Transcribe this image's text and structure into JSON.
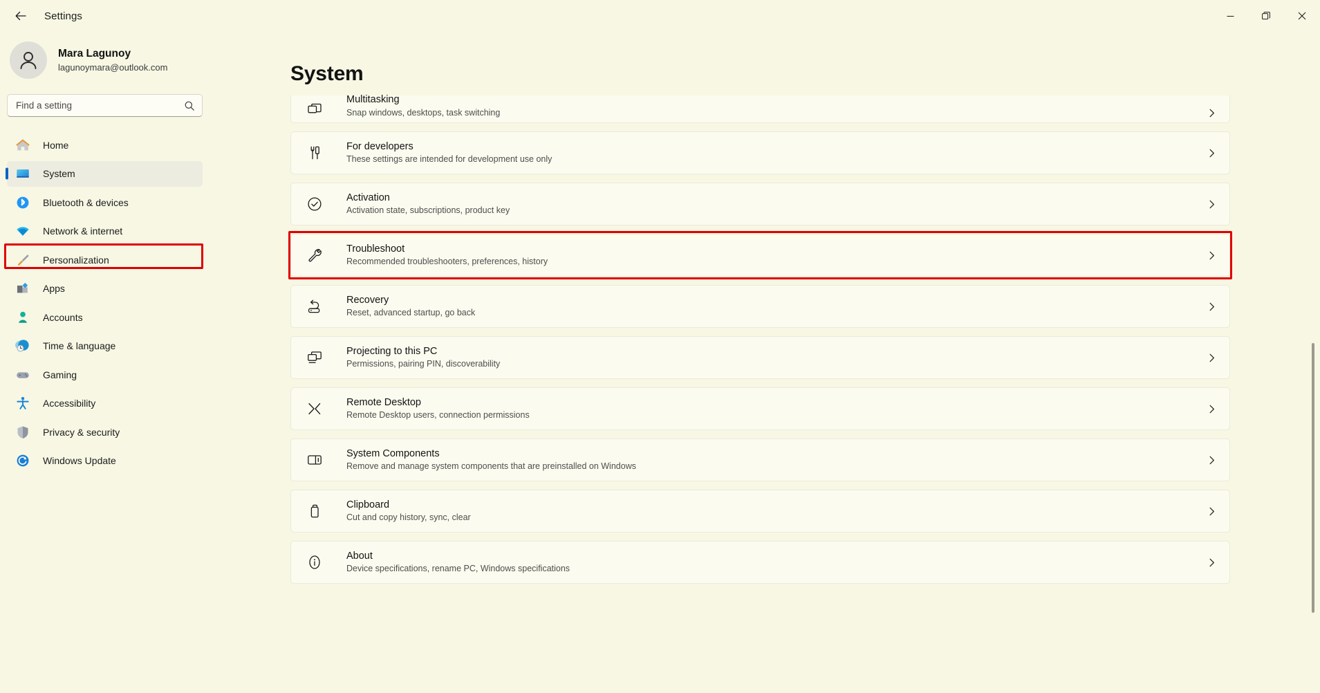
{
  "window": {
    "title": "Settings",
    "back_icon": "back-arrow-icon",
    "minimize_label": "Minimize",
    "maximize_label": "Restore",
    "close_label": "Close"
  },
  "account": {
    "name": "Mara Lagunoy",
    "email": "lagunoymara@outlook.com",
    "avatar_icon": "person-avatar-icon"
  },
  "search": {
    "placeholder": "Find a setting",
    "value": "",
    "icon": "search-icon"
  },
  "sidebar": {
    "items": [
      {
        "label": "Home",
        "icon": "home-icon",
        "selected": false
      },
      {
        "label": "System",
        "icon": "system-monitor-icon",
        "selected": true
      },
      {
        "label": "Bluetooth & devices",
        "icon": "bluetooth-icon",
        "selected": false
      },
      {
        "label": "Network & internet",
        "icon": "wifi-icon",
        "selected": false
      },
      {
        "label": "Personalization",
        "icon": "paintbrush-icon",
        "selected": false
      },
      {
        "label": "Apps",
        "icon": "apps-icon",
        "selected": false
      },
      {
        "label": "Accounts",
        "icon": "account-person-icon",
        "selected": false
      },
      {
        "label": "Time & language",
        "icon": "clock-globe-icon",
        "selected": false
      },
      {
        "label": "Gaming",
        "icon": "gamepad-icon",
        "selected": false
      },
      {
        "label": "Accessibility",
        "icon": "accessibility-person-icon",
        "selected": false
      },
      {
        "label": "Privacy & security",
        "icon": "shield-icon",
        "selected": false
      },
      {
        "label": "Windows Update",
        "icon": "update-refresh-icon",
        "selected": false
      }
    ]
  },
  "main": {
    "page_title": "System",
    "chevron_icon": "chevron-right-icon",
    "rows": [
      {
        "title": "Multitasking",
        "subtitle": "Snap windows, desktops, task switching",
        "icon": "multitasking-windows-icon",
        "clipped": true,
        "highlighted": false
      },
      {
        "title": "For developers",
        "subtitle": "These settings are intended for development use only",
        "icon": "developer-tools-icon",
        "clipped": false,
        "highlighted": false
      },
      {
        "title": "Activation",
        "subtitle": "Activation state, subscriptions, product key",
        "icon": "checkmark-circle-icon",
        "clipped": false,
        "highlighted": false
      },
      {
        "title": "Troubleshoot",
        "subtitle": "Recommended troubleshooters, preferences, history",
        "icon": "wrench-icon",
        "clipped": false,
        "highlighted": true
      },
      {
        "title": "Recovery",
        "subtitle": "Reset, advanced startup, go back",
        "icon": "recovery-arrow-icon",
        "clipped": false,
        "highlighted": false
      },
      {
        "title": "Projecting to this PC",
        "subtitle": "Permissions, pairing PIN, discoverability",
        "icon": "projecting-screens-icon",
        "clipped": false,
        "highlighted": false
      },
      {
        "title": "Remote Desktop",
        "subtitle": "Remote Desktop users, connection permissions",
        "icon": "remote-desktop-icon",
        "clipped": false,
        "highlighted": false
      },
      {
        "title": "System Components",
        "subtitle": "Remove and manage system components that are preinstalled on Windows",
        "icon": "system-components-icon",
        "clipped": false,
        "highlighted": false
      },
      {
        "title": "Clipboard",
        "subtitle": "Cut and copy history, sync, clear",
        "icon": "clipboard-icon",
        "clipped": false,
        "highlighted": false
      },
      {
        "title": "About",
        "subtitle": "Device specifications, rename PC, Windows specifications",
        "icon": "info-circle-icon",
        "clipped": false,
        "highlighted": false
      }
    ]
  },
  "annotations": {
    "color": "#e00000",
    "boxes": [
      {
        "target": "sidebar-item-system"
      },
      {
        "target": "settings-row-troubleshoot"
      }
    ]
  },
  "colors": {
    "background": "#f7f7e4",
    "card": "#fbfbef",
    "accent": "#0d62c3",
    "annotation": "#e00000"
  }
}
